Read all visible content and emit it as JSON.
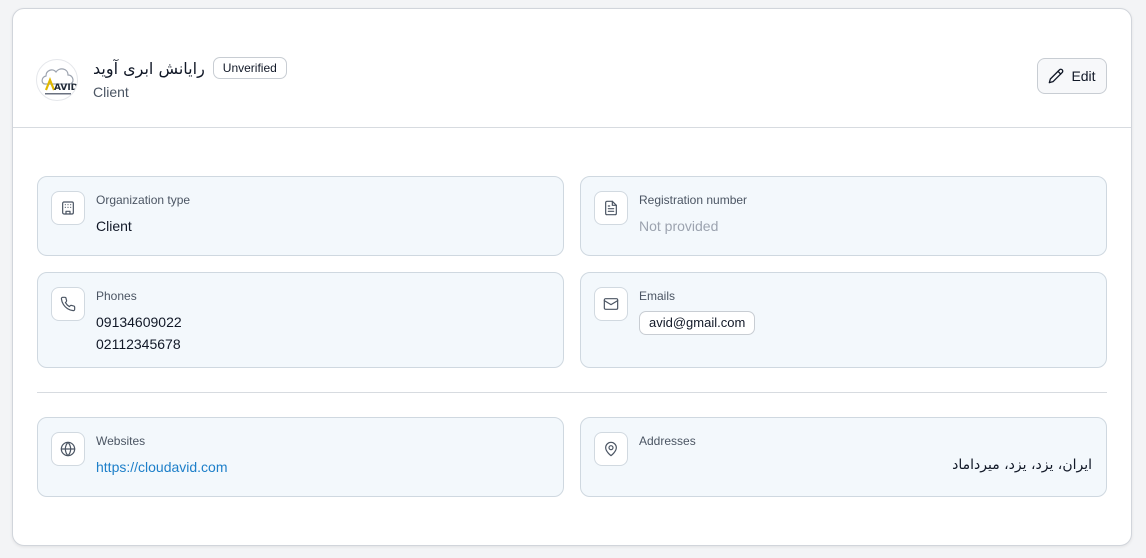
{
  "header": {
    "logo": {
      "icon": "avid-cloud-logo",
      "brand_text": "AVID"
    },
    "title": "رایانش ابری آوید",
    "badge": "Unverified",
    "subtitle": "Client",
    "edit_label": "Edit"
  },
  "fields": {
    "organization_type": {
      "label": "Organization type",
      "value": "Client",
      "icon": "building-icon"
    },
    "registration_number": {
      "label": "Registration number",
      "value": "Not provided",
      "icon": "document-icon"
    },
    "phones": {
      "label": "Phones",
      "values": [
        "09134609022",
        "02112345678"
      ],
      "icon": "phone-icon"
    },
    "emails": {
      "label": "Emails",
      "values": [
        "avid@gmail.com"
      ],
      "icon": "mail-icon"
    },
    "websites": {
      "label": "Websites",
      "values": [
        "https://cloudavid.com"
      ],
      "icon": "globe-icon"
    },
    "addresses": {
      "label": "Addresses",
      "values": [
        "ایران، یزد، یزد، میرداماد"
      ],
      "icon": "map-pin-icon"
    }
  },
  "colors": {
    "tile_bg": "#f3f8fc",
    "tile_border": "#cfd8e0",
    "link": "#1d7fc9",
    "muted": "#9ca3af"
  }
}
